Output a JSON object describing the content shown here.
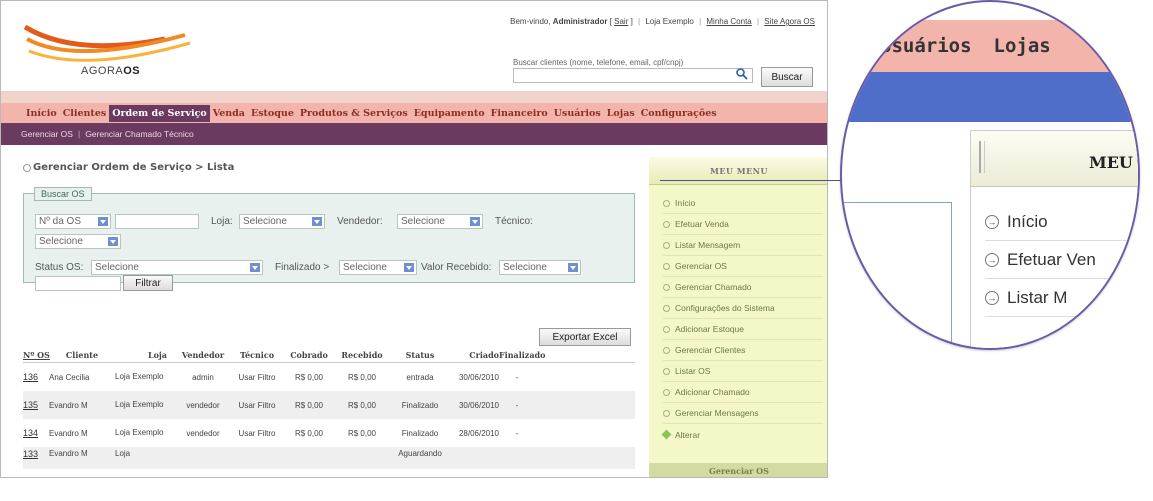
{
  "header": {
    "logo_text_plain": "AGORA",
    "logo_text_bold": "OS",
    "welcome_text": "Bem-vindo, ",
    "user_name": "Administrador",
    "logout_label": "Sair",
    "store_label": "Loja Exemplo",
    "my_account_label": "Minha Conta",
    "site_label": "Site Agora OS",
    "search_label": "Buscar clientes (nome, telefone, email, cpf/cnpj)",
    "search_value": "",
    "search_button": "Buscar"
  },
  "nav": {
    "items": [
      "Início",
      "Clientes",
      "Ordem de Serviço",
      "Venda",
      "Estoque",
      "Produtos & Serviços",
      "Equipamento",
      "Financeiro",
      "Usuários",
      "Lojas",
      "Configurações"
    ],
    "active_index": 2
  },
  "subnav": {
    "items": [
      "Gerenciar OS",
      "Gerenciar Chamado Técnico"
    ]
  },
  "content": {
    "breadcrumb": "Gerenciar Ordem de Serviço > Lista",
    "filter_title": "Buscar OS",
    "os_field_select": "Nº da OS",
    "loja_label": "Loja:",
    "loja_value": "Selecione",
    "vendedor_label": "Vendedor:",
    "vendedor_value": "Selecione",
    "tecnico_label": "Técnico:",
    "tecnico_value": "Selecione",
    "status_label": "Status OS:",
    "status_value": "Selecione",
    "finalizado_label": "Finalizado >",
    "finalizado_value": "Selecione",
    "valor_label": "Valor Recebido:",
    "valor_value": "Selecione",
    "filter_button": "Filtrar",
    "export_button": "Exportar Excel"
  },
  "table": {
    "columns": [
      "Nº OS",
      "Cliente",
      "Loja",
      "Vendedor",
      "Técnico",
      "Cobrado",
      "Recebido",
      "Status",
      "Criado",
      "Finalizado"
    ],
    "rows": [
      {
        "os": "136",
        "cliente": "Ana Cecilia",
        "loja": "Loja Exemplo",
        "vendedor": "admin",
        "tecnico": "Usar Filtro",
        "cobrado": "R$ 0,00",
        "recebido": "R$ 0,00",
        "status": "entrada",
        "criado": "30/06/2010",
        "finalizado": "-"
      },
      {
        "os": "135",
        "cliente": "Evandro M",
        "loja": "Loja Exemplo",
        "vendedor": "vendedor",
        "tecnico": "Usar Filtro",
        "cobrado": "R$ 0,00",
        "recebido": "R$ 0,00",
        "status": "Finalizado",
        "criado": "30/06/2010",
        "finalizado": "-"
      },
      {
        "os": "134",
        "cliente": "Evandro M",
        "loja": "Loja Exemplo",
        "vendedor": "vendedor",
        "tecnico": "Usar Filtro",
        "cobrado": "R$ 0,00",
        "recebido": "R$ 0,00",
        "status": "Finalizado",
        "criado": "28/06/2010",
        "finalizado": "-"
      },
      {
        "os": "133",
        "cliente": "Evandro M",
        "loja": "Loja",
        "vendedor": "",
        "tecnico": "",
        "cobrado": "",
        "recebido": "",
        "status": "Aguardando",
        "criado": "",
        "finalizado": ""
      }
    ]
  },
  "sidebar": {
    "title": "MEU MENU",
    "items": [
      "Início",
      "Efetuar Venda",
      "Listar Mensagem",
      "Gerenciar OS",
      "Gerenciar Chamado",
      "Configurações do Sistema",
      "Adicionar Estoque",
      "Gerenciar Clientes",
      "Listar OS",
      "Adicionar Chamado",
      "Gerenciar Mensagens"
    ],
    "alter_label": "Alterar",
    "footer_title": "Gerenciar OS"
  },
  "magnifier": {
    "nav_items": [
      "Usuários",
      "Lojas"
    ],
    "menu_title": "MEU",
    "items": [
      "Início",
      "Efetuar Ven",
      "Listar M"
    ]
  },
  "colors": {
    "nav_bg": "#f3b4ac",
    "nav_active": "#6b3a60",
    "sidebar_bg": "#f4f7c8",
    "magnifier_border": "#6a5aa8"
  }
}
